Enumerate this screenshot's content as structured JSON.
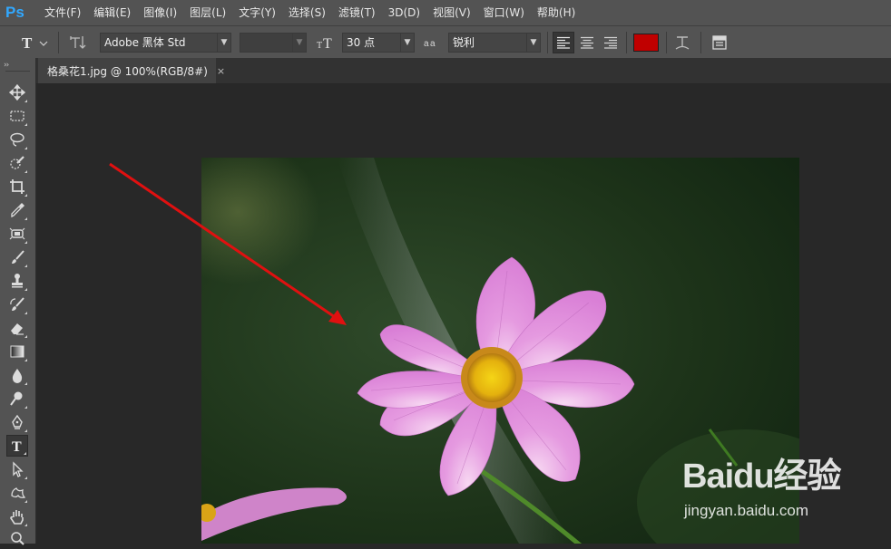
{
  "app": {
    "logo": "Ps"
  },
  "menu": [
    "文件(F)",
    "编辑(E)",
    "图像(I)",
    "图层(L)",
    "文字(Y)",
    "选择(S)",
    "滤镜(T)",
    "3D(D)",
    "视图(V)",
    "窗口(W)",
    "帮助(H)"
  ],
  "options": {
    "tool_icon": "text-tool-icon",
    "orientation_icon": "text-orientation-icon",
    "font_family": "Adobe 黑体 Std",
    "font_style": "",
    "font_size_icon": "font-size-icon",
    "font_size": "30 点",
    "antialias_icon": "antialias-icon",
    "antialias": "锐利",
    "align": [
      "left",
      "center",
      "right"
    ],
    "active_align": "left",
    "text_color": "#c00000",
    "warp_icon": "warp-text-icon",
    "panel_icon": "character-panel-icon"
  },
  "tab": {
    "title": "格桑花1.jpg @ 100%(RGB/8#)",
    "close": "×"
  },
  "toolbar": {
    "grip": "››",
    "tools": [
      "move",
      "marquee",
      "lasso",
      "quick-select",
      "crop",
      "eyedropper",
      "patch",
      "brush",
      "stamp",
      "history-brush",
      "eraser",
      "gradient",
      "blur",
      "dodge",
      "pen",
      "type",
      "path-select",
      "shape",
      "hand",
      "zoom"
    ],
    "active": "type"
  },
  "annotation": {
    "arrow_color": "#e01010"
  },
  "watermark": {
    "brand": "Baidu经验",
    "url": "jingyan.baidu.com"
  }
}
